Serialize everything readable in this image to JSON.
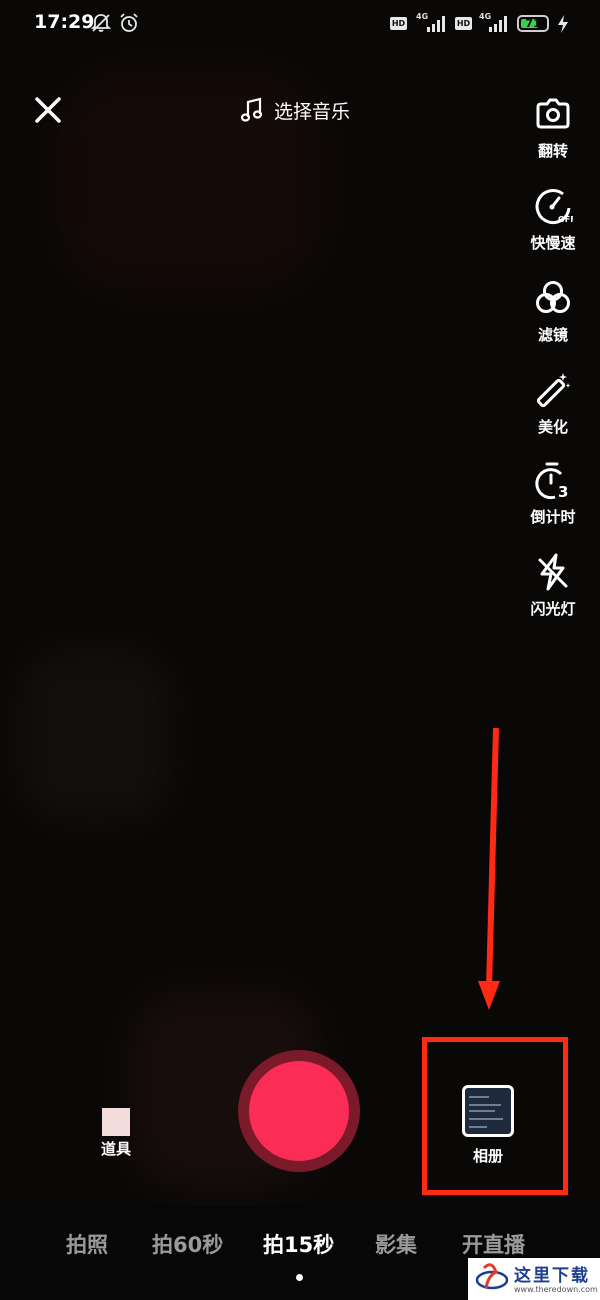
{
  "status": {
    "time": "17:29",
    "hd1": "HD",
    "net1": "4G",
    "hd2": "HD",
    "net2": "4G",
    "battery": "71",
    "battery_level": 0.71
  },
  "top": {
    "music_label": "选择音乐"
  },
  "tools": [
    {
      "label": "翻转",
      "icon": "flip-camera-icon"
    },
    {
      "label": "快慢速",
      "icon": "speed-icon"
    },
    {
      "label": "滤镜",
      "icon": "filter-icon"
    },
    {
      "label": "美化",
      "icon": "beautify-wand-icon"
    },
    {
      "label": "倒计时",
      "icon": "countdown-timer-icon"
    },
    {
      "label": "闪光灯",
      "icon": "flash-off-icon"
    }
  ],
  "bottom": {
    "effects_label": "道具",
    "album_label": "相册"
  },
  "modes": [
    "拍照",
    "拍60秒",
    "拍15秒",
    "影集",
    "开直播"
  ],
  "active_mode": "拍15秒",
  "watermark": {
    "text": "这里下载",
    "url": "www.theredown.com"
  },
  "colors": {
    "shutter": "#fb2c55",
    "highlight": "#ff2a14"
  }
}
